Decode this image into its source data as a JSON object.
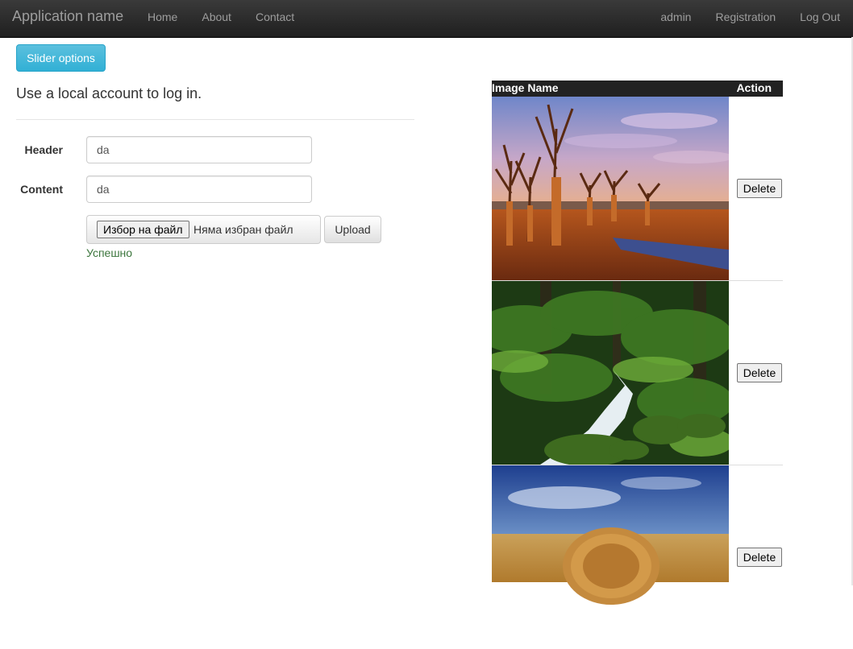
{
  "navbar": {
    "brand": "Application name",
    "left_links": [
      "Home",
      "About",
      "Contact"
    ],
    "right_links": [
      "admin",
      "Registration",
      "Log Out"
    ]
  },
  "slider_button": "Slider options",
  "lead": "Use a local account to log in.",
  "form": {
    "header_label": "Header",
    "header_value": "da",
    "content_label": "Content",
    "content_value": "da",
    "file_button": "Избор на файл",
    "file_status": "Няма избран файл",
    "upload_button": "Upload",
    "success_message": "Успешно"
  },
  "table": {
    "col_image_name": "Image Name",
    "col_action": "Action",
    "rows": [
      {
        "image": "baobab-landscape",
        "action": "Delete"
      },
      {
        "image": "forest-waterfall",
        "action": "Delete"
      },
      {
        "image": "hay-bale-field",
        "action": "Delete"
      }
    ]
  },
  "colors": {
    "navbar_bg": "#222222",
    "info_button": "#31b0d5",
    "success_text": "#3c763d"
  }
}
